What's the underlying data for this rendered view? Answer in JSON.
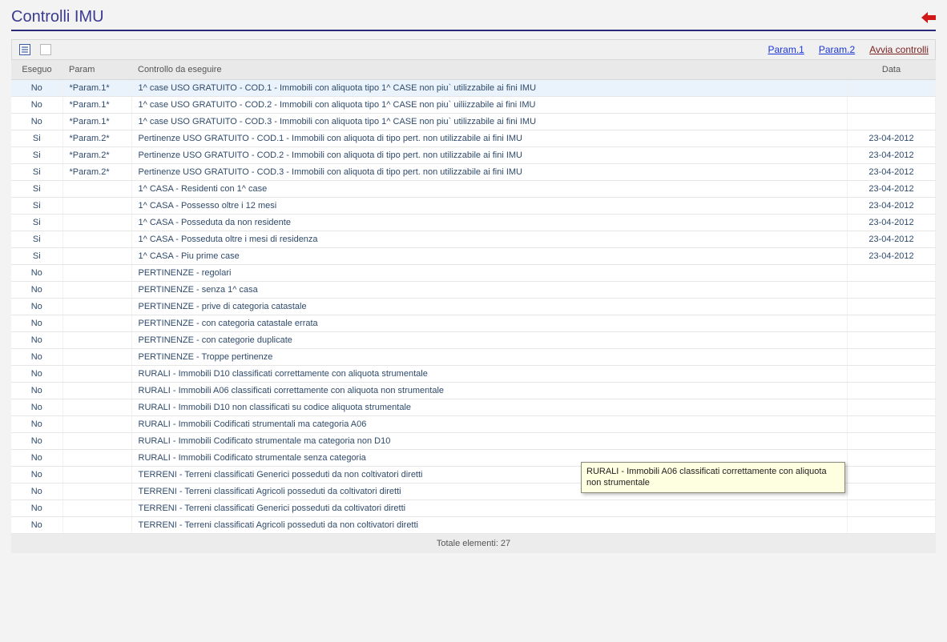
{
  "title": "Controlli IMU",
  "toolbar": {
    "param1": "Param.1",
    "param2": "Param.2",
    "avvia": "Avvia controlli"
  },
  "columns": {
    "eseguo": "Eseguo",
    "param": "Param",
    "desc": "Controllo da eseguire",
    "data": "Data"
  },
  "rows": [
    {
      "eseguo": "No",
      "param": "*Param.1*",
      "desc": "1^ case USO GRATUITO - COD.1 - Immobili con aliquota tipo 1^ CASE non piu` utilizzabile ai fini IMU",
      "data": ""
    },
    {
      "eseguo": "No",
      "param": "*Param.1*",
      "desc": "1^ case USO GRATUITO - COD.2 - Immobili con aliquota tipo 1^ CASE non piu` uiliizzabile ai fini IMU",
      "data": ""
    },
    {
      "eseguo": "No",
      "param": "*Param.1*",
      "desc": "1^ case USO GRATUITO - COD.3 - Immobili con aliquota tipo 1^ CASE non piu` utilizzabile ai fini IMU",
      "data": ""
    },
    {
      "eseguo": "Si",
      "param": "*Param.2*",
      "desc": "Pertinenze USO GRATUITO - COD.1 - Immobili con aliquota di tipo pert. non utilizzabile ai fini IMU",
      "data": "23-04-2012"
    },
    {
      "eseguo": "Si",
      "param": "*Param.2*",
      "desc": "Pertinenze USO GRATUITO - COD.2 - Immobili con aliquota di tipo pert. non utilizzabile ai fini IMU",
      "data": "23-04-2012"
    },
    {
      "eseguo": "Si",
      "param": "*Param.2*",
      "desc": "Pertinenze USO GRATUITO - COD.3 - Immobili con aliquota di tipo pert. non utilizzabile ai fini IMU",
      "data": "23-04-2012"
    },
    {
      "eseguo": "Si",
      "param": "",
      "desc": "1^ CASA - Residenti con 1^ case",
      "data": "23-04-2012"
    },
    {
      "eseguo": "Si",
      "param": "",
      "desc": "1^ CASA - Possesso oltre i 12 mesi",
      "data": "23-04-2012"
    },
    {
      "eseguo": "Si",
      "param": "",
      "desc": "1^ CASA - Posseduta da non residente",
      "data": "23-04-2012"
    },
    {
      "eseguo": "Si",
      "param": "",
      "desc": "1^ CASA - Posseduta oltre i mesi di residenza",
      "data": "23-04-2012"
    },
    {
      "eseguo": "Si",
      "param": "",
      "desc": "1^ CASA - Piu prime case",
      "data": "23-04-2012"
    },
    {
      "eseguo": "No",
      "param": "",
      "desc": "PERTINENZE - regolari",
      "data": ""
    },
    {
      "eseguo": "No",
      "param": "",
      "desc": "PERTINENZE - senza 1^ casa",
      "data": ""
    },
    {
      "eseguo": "No",
      "param": "",
      "desc": "PERTINENZE - prive di categoria catastale",
      "data": ""
    },
    {
      "eseguo": "No",
      "param": "",
      "desc": "PERTINENZE - con categoria catastale errata",
      "data": ""
    },
    {
      "eseguo": "No",
      "param": "",
      "desc": "PERTINENZE - con categorie duplicate",
      "data": ""
    },
    {
      "eseguo": "No",
      "param": "",
      "desc": "PERTINENZE - Troppe pertinenze",
      "data": ""
    },
    {
      "eseguo": "No",
      "param": "",
      "desc": "RURALI - Immobili D10 classificati correttamente con aliquota strumentale",
      "data": ""
    },
    {
      "eseguo": "No",
      "param": "",
      "desc": "RURALI - Immobili A06 classificati correttamente con aliquota non strumentale",
      "data": ""
    },
    {
      "eseguo": "No",
      "param": "",
      "desc": "RURALI - Immobili D10 non classificati su codice aliquota strumentale",
      "data": ""
    },
    {
      "eseguo": "No",
      "param": "",
      "desc": "RURALI - Immobili Codificati strumentali ma categoria A06",
      "data": ""
    },
    {
      "eseguo": "No",
      "param": "",
      "desc": "RURALI - Immobili Codificato strumentale ma categoria non D10",
      "data": ""
    },
    {
      "eseguo": "No",
      "param": "",
      "desc": "RURALI - Immobili Codificato strumentale senza categoria",
      "data": ""
    },
    {
      "eseguo": "No",
      "param": "",
      "desc": "TERRENI - Terreni classificati Generici posseduti da non coltivatori diretti",
      "data": ""
    },
    {
      "eseguo": "No",
      "param": "",
      "desc": "TERRENI - Terreni classificati Agricoli posseduti da coltivatori diretti",
      "data": ""
    },
    {
      "eseguo": "No",
      "param": "",
      "desc": "TERRENI - Terreni classificati Generici posseduti da coltivatori diretti",
      "data": ""
    },
    {
      "eseguo": "No",
      "param": "",
      "desc": "TERRENI - Terreni classificati Agricoli posseduti da non coltivatori diretti",
      "data": ""
    }
  ],
  "footer": "Totale elementi: 27",
  "tooltip": "RURALI - Immobili A06 classificati correttamente con aliquota non strumentale"
}
